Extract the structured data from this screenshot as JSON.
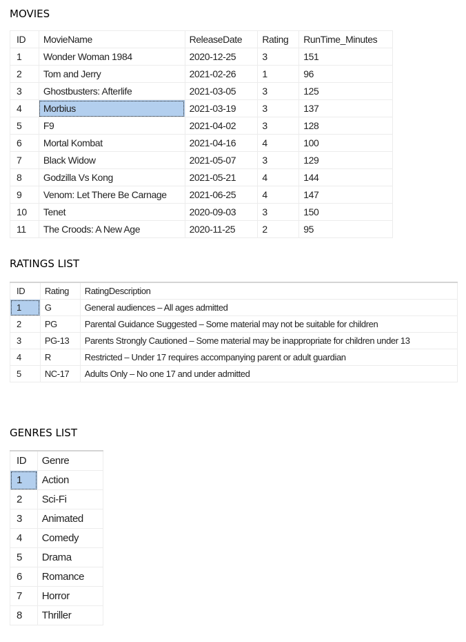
{
  "movies": {
    "title": "MOVIES",
    "columns": [
      "ID",
      "MovieName",
      "ReleaseDate",
      "Rating",
      "RunTime_Minutes"
    ],
    "rows": [
      [
        "1",
        "Wonder Woman 1984",
        "2020-12-25",
        "3",
        "151"
      ],
      [
        "2",
        "Tom and Jerry",
        "2021-02-26",
        "1",
        "96"
      ],
      [
        "3",
        "Ghostbusters: Afterlife",
        "2021-03-05",
        "3",
        "125"
      ],
      [
        "4",
        "Morbius",
        "2021-03-19",
        "3",
        "137"
      ],
      [
        "5",
        "F9",
        "2021-04-02",
        "3",
        "128"
      ],
      [
        "6",
        "Mortal Kombat",
        "2021-04-16",
        "4",
        "100"
      ],
      [
        "7",
        "Black Widow",
        "2021-05-07",
        "3",
        "129"
      ],
      [
        "8",
        "Godzilla Vs Kong",
        "2021-05-21",
        "4",
        "144"
      ],
      [
        "9",
        "Venom: Let There Be Carnage",
        "2021-06-25",
        "4",
        "147"
      ],
      [
        "10",
        "Tenet",
        "2020-09-03",
        "3",
        "150"
      ],
      [
        "11",
        "The Croods: A New Age",
        "2020-11-25",
        "2",
        "95"
      ]
    ],
    "selected_cell": {
      "row": 3,
      "col": 1
    }
  },
  "ratings": {
    "title": "RATINGS LIST",
    "columns": [
      "ID",
      "Rating",
      "RatingDescription"
    ],
    "rows": [
      [
        "1",
        "G",
        "General audiences – All ages admitted"
      ],
      [
        "2",
        "PG",
        "Parental Guidance Suggested – Some material may not be suitable for children"
      ],
      [
        "3",
        "PG-13",
        "Parents Strongly Cautioned – Some material may be inappropriate for children under 13"
      ],
      [
        "4",
        "R",
        "Restricted – Under 17 requires accompanying parent or adult guardian"
      ],
      [
        "5",
        "NC-17",
        "Adults Only – No one 17 and under admitted"
      ]
    ],
    "selected_cell": {
      "row": 0,
      "col": 0
    }
  },
  "genres": {
    "title": "GENRES LIST",
    "columns": [
      "ID",
      "Genre"
    ],
    "rows": [
      [
        "1",
        "Action"
      ],
      [
        "2",
        "Sci-Fi"
      ],
      [
        "3",
        "Animated"
      ],
      [
        "4",
        "Comedy"
      ],
      [
        "5",
        "Drama"
      ],
      [
        "6",
        "Romance"
      ],
      [
        "7",
        "Horror"
      ],
      [
        "8",
        "Thriller"
      ]
    ],
    "selected_cell": {
      "row": 0,
      "col": 0
    }
  },
  "colors": {
    "selection": "#b3cfee",
    "grid_line": "#ececec"
  }
}
